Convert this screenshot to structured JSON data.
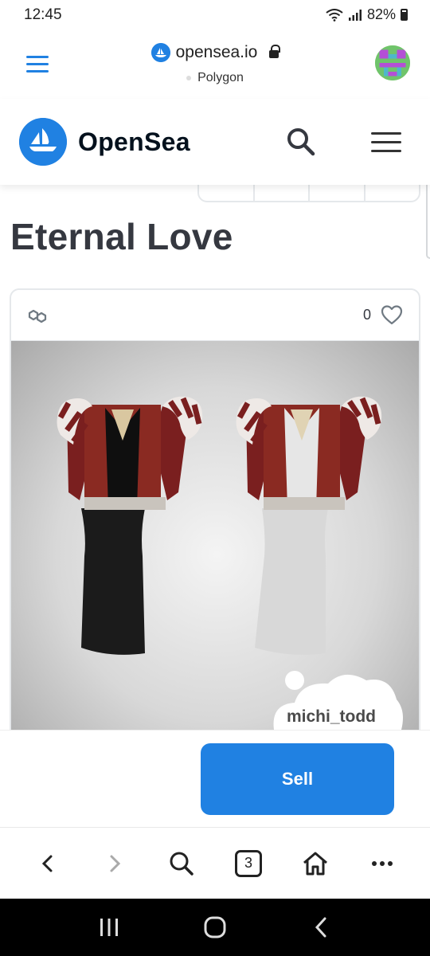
{
  "status_bar": {
    "time": "12:45",
    "battery_text": "82%",
    "icons": [
      "wifi-icon",
      "signal-icon",
      "battery-icon"
    ]
  },
  "browser": {
    "url": "opensea.io",
    "network": "Polygon",
    "tab_count": "3",
    "toolbar_icons": [
      "back-icon",
      "forward-icon",
      "search-icon",
      "tabs-icon",
      "home-icon",
      "more-icon"
    ]
  },
  "opensea_header": {
    "brand": "OpenSea",
    "icons": [
      "opensea-logo-icon",
      "search-icon",
      "menu-icon"
    ]
  },
  "item": {
    "title": "Eternal Love",
    "favorite_count": "0",
    "watermark": "michi_todd"
  },
  "actions": {
    "sell_label": "Sell"
  },
  "colors": {
    "accent": "#2081e2",
    "title": "#353840",
    "border": "#e5e8eb",
    "robe_red": "#7a1f1f"
  },
  "android_nav": {
    "icons": [
      "recents-icon",
      "home-circle-icon",
      "back-chevron-icon"
    ]
  }
}
